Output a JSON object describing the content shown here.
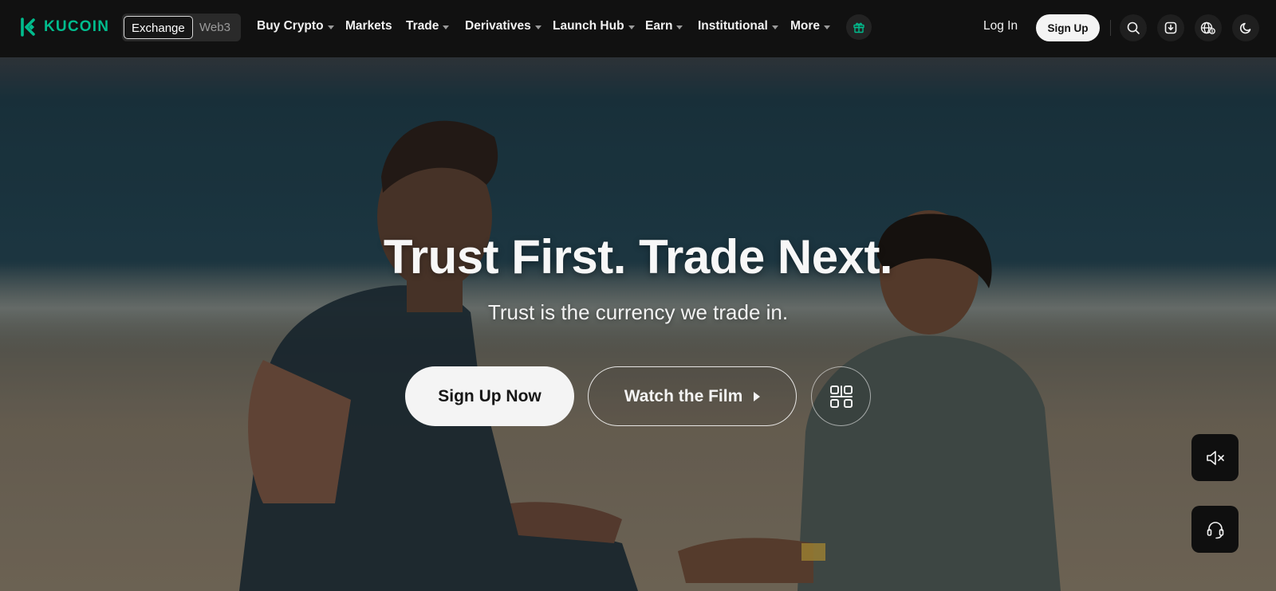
{
  "nav": {
    "brand": "KUCOIN",
    "switch": {
      "active": "Exchange",
      "inactive": "Web3"
    },
    "menu": [
      {
        "label": "Buy Crypto",
        "has_caret": true
      },
      {
        "label": "Markets",
        "has_caret": false
      },
      {
        "label": "Trade",
        "has_caret": true
      },
      {
        "label": "Derivatives",
        "has_caret": true
      },
      {
        "label": "Launch Hub",
        "has_caret": true
      },
      {
        "label": "Earn",
        "has_caret": true
      },
      {
        "label": "Institutional",
        "has_caret": true
      },
      {
        "label": "More",
        "has_caret": true
      }
    ],
    "login_label": "Log In",
    "signup_label": "Sign Up",
    "icons": [
      "gift-icon",
      "search-icon",
      "download-icon",
      "globe-currency-icon",
      "moon-icon"
    ]
  },
  "hero": {
    "headline": "Trust First. Trade Next.",
    "subline": "Trust is the currency we trade in.",
    "primary_cta": "Sign Up Now",
    "secondary_cta": "Watch the Film",
    "icons": [
      "play-icon",
      "qr-code-icon"
    ]
  },
  "floating": {
    "icons": [
      "speaker-muted-icon",
      "headset-support-icon"
    ]
  },
  "colors": {
    "brand": "#01bc8d",
    "nav_bg": "#111111",
    "button_light": "#f4f4f4"
  }
}
